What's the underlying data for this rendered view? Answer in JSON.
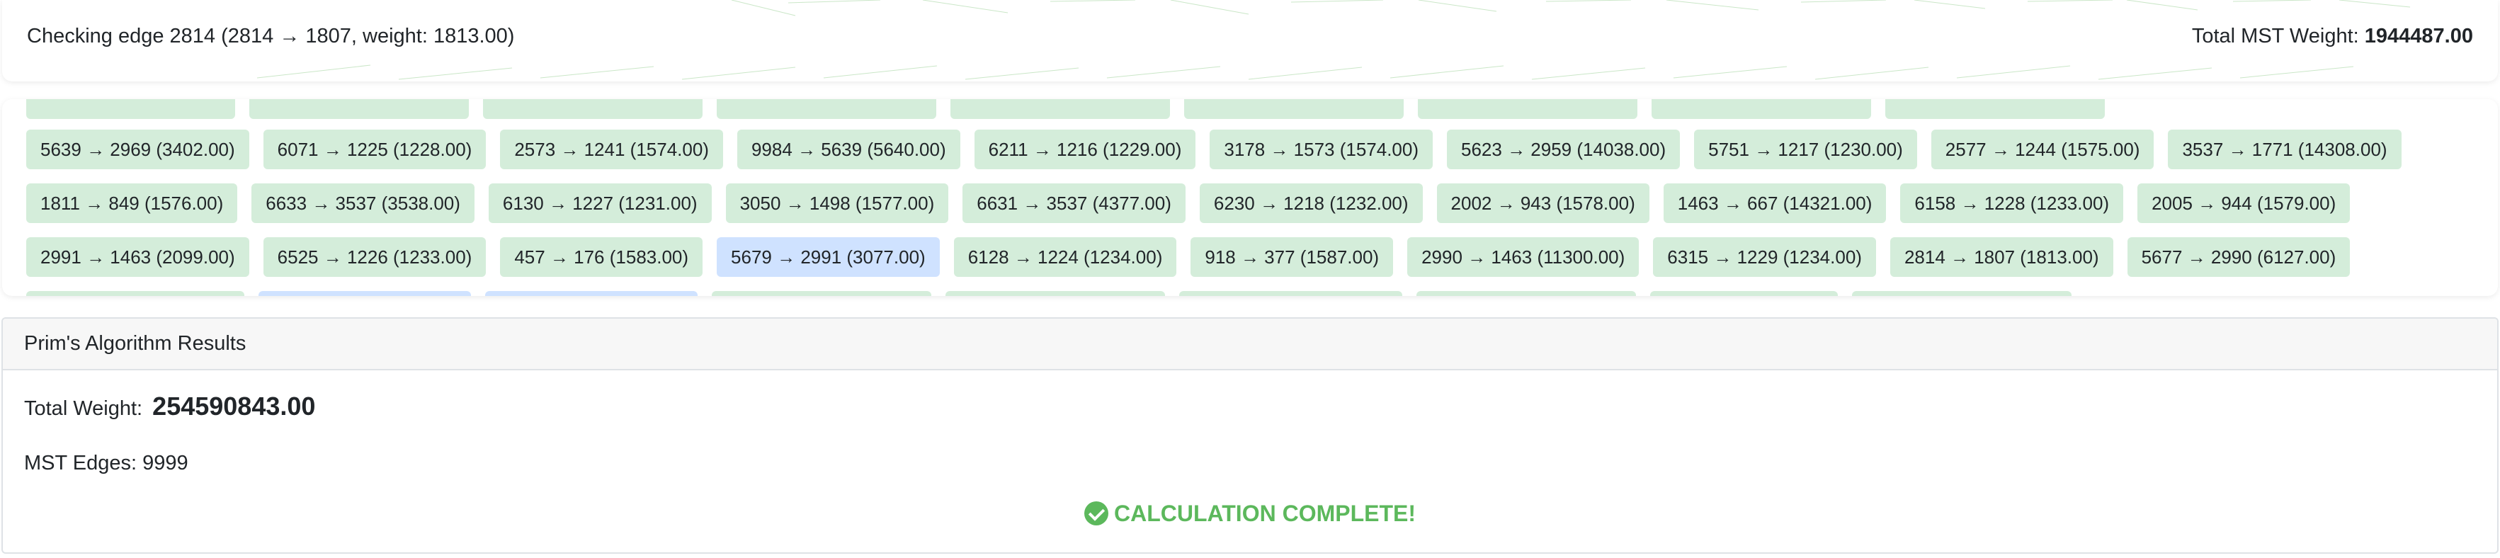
{
  "status": {
    "checking_text": "Checking edge 2814 (2814 → 1807, weight: 1813.00)",
    "total_label": "Total MST Weight:",
    "total_value": "1944487.00"
  },
  "edges": {
    "top_partial_row": [
      "",
      "",
      "",
      "",
      "",
      "",
      "",
      "",
      "",
      ""
    ],
    "row1": [
      "5639 → 2969 (3402.00)",
      "6071 → 1225 (1228.00)",
      "2573 → 1241 (1574.00)",
      "9984 → 5639 (5640.00)",
      "6211 → 1216 (1229.00)",
      "3178 → 1573 (1574.00)",
      "5623 → 2959 (14038.00)",
      "5751 → 1217 (1230.00)",
      "2577 → 1244 (1575.00)",
      "3537 → 1771 (14308.00)"
    ],
    "row2": [
      "1811 → 849 (1576.00)",
      "6633 → 3537 (3538.00)",
      "6130 → 1227 (1231.00)",
      "3050 → 1498 (1577.00)",
      "6631 → 3537 (4377.00)",
      "6230 → 1218 (1232.00)",
      "2002 → 943 (1578.00)",
      "1463 → 667 (14321.00)",
      "6158 → 1228 (1233.00)",
      "2005 → 944 (1579.00)"
    ],
    "row3": [
      "2991 → 1463 (2099.00)",
      "6525 → 1226 (1233.00)",
      "457 → 176 (1583.00)",
      "5679 → 2991 (3077.00)",
      "6128 → 1224 (1234.00)",
      "918 → 377 (1587.00)",
      "2990 → 1463 (11300.00)",
      "6315 → 1229 (1234.00)",
      "2814 → 1807 (1813.00)",
      "5677 → 2990 (6127.00)"
    ],
    "bottom_partial_row": [
      "",
      "",
      "",
      "",
      "",
      "",
      "",
      "",
      "",
      ""
    ]
  },
  "results": {
    "header": "Prim's Algorithm Results",
    "total_label": "Total Weight:",
    "total_value": "254590843.00",
    "edges_label": "MST Edges: 9999",
    "complete_text": "CALCULATION COMPLETE!"
  },
  "colors": {
    "edge_badge": "#d4edda",
    "edge_active": "#cfe2ff",
    "success": "#5cb85c"
  },
  "icons": {
    "complete": "check-circle-icon"
  }
}
